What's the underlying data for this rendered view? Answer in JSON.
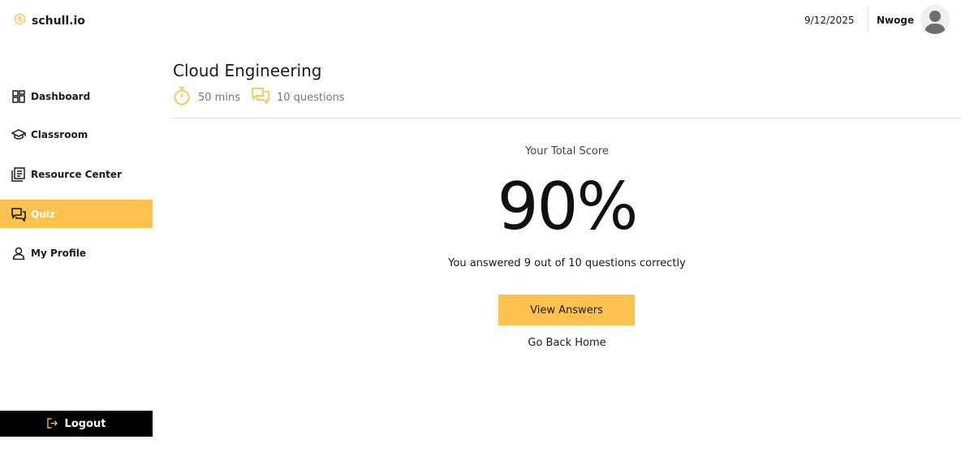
{
  "brand": {
    "name": "schull.io"
  },
  "header": {
    "date": "9/12/2025",
    "username": "Nwoge"
  },
  "sidebar": {
    "items": [
      {
        "label": "Dashboard",
        "icon": "dashboard-grid-icon",
        "active": false
      },
      {
        "label": "Classroom",
        "icon": "graduation-cap-icon",
        "active": false
      },
      {
        "label": "Resource Center",
        "icon": "library-icon",
        "active": false
      },
      {
        "label": "Quiz",
        "icon": "chat-bubbles-icon",
        "active": true
      },
      {
        "label": "My Profile",
        "icon": "user-icon",
        "active": false
      }
    ],
    "logout_label": "Logout"
  },
  "quiz": {
    "title": "Cloud Engineering",
    "duration": "50 mins",
    "questions": "10 questions"
  },
  "result": {
    "label": "Your Total Score",
    "score": "90%",
    "summary": "You answered 9 out of 10 questions correctly",
    "view_answers_label": "View Answers",
    "go_home_label": "Go Back Home"
  },
  "colors": {
    "accent": "#fdc14f",
    "logout_bg": "#000000",
    "text": "#1a1a1a",
    "muted": "#777777"
  }
}
